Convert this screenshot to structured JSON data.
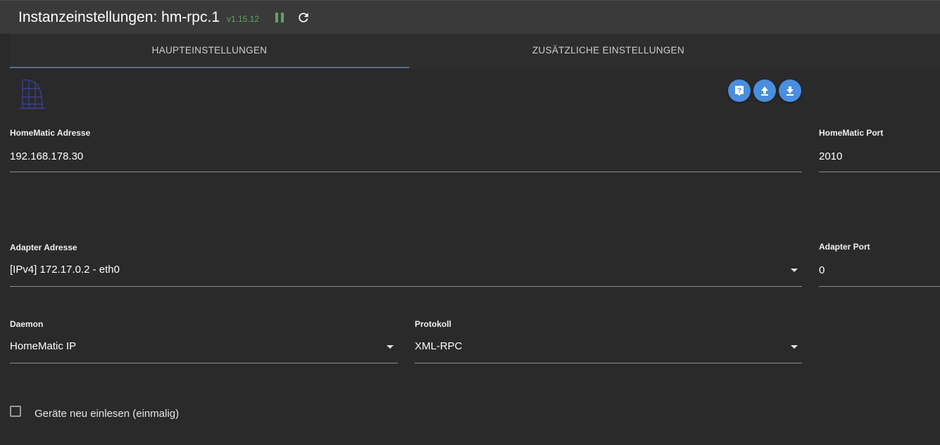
{
  "header": {
    "title": "Instanzeinstellungen: hm-rpc.1",
    "version": "v1.15.12",
    "icons": [
      "pause-icon",
      "reload-icon"
    ],
    "version_color": "#5ba85b"
  },
  "tabs": [
    {
      "label": "HAUPTEINSTELLUNGEN",
      "active": true
    },
    {
      "label": "ZUSÄTZLICHE EINSTELLUNGEN",
      "active": false
    }
  ],
  "toolbar": {
    "buttons": [
      "help-icon",
      "upload-icon",
      "download-icon"
    ],
    "accent": "#4a8ede"
  },
  "form": {
    "homematic_address": {
      "label": "HomeMatic Adresse",
      "value": "192.168.178.30"
    },
    "homematic_port": {
      "label": "HomeMatic Port",
      "value": "2010"
    },
    "adapter_address": {
      "label": "Adapter Adresse",
      "value": "[IPv4] 172.17.0.2 - eth0"
    },
    "adapter_port": {
      "label": "Adapter Port",
      "value": "0"
    },
    "daemon": {
      "label": "Daemon",
      "value": "HomeMatic IP"
    },
    "protocol": {
      "label": "Protokoll",
      "value": "XML-RPC"
    },
    "reread_devices": {
      "label": "Geräte neu einlesen (einmalig)",
      "checked": false
    }
  }
}
